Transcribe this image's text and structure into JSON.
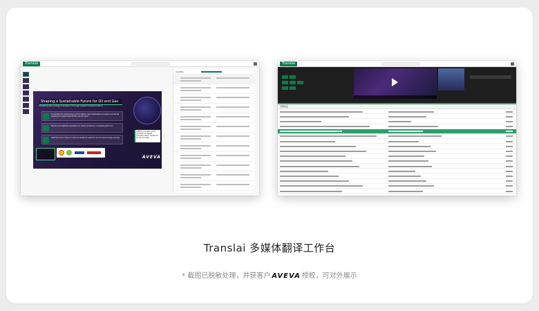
{
  "left_screenshot": {
    "app_logo": "Translai",
    "slide": {
      "title": "Shaping a Sustainable Future for Oil and Gas",
      "subtitle": "Enabling the energy transition through digital transformation",
      "bullets": [
        "Accelerate the engineering cycle to design new sustainable processes and retrofit existing processes towards the net-zero goal",
        "Monitor and optimize operations to reduce emissions, increasing plant and ",
        "Optimize value chains to improve feedstock selection and increase energy savings"
      ],
      "callout_text": "AVEVA provides a full portfolio of digital transformation solutions for Oil and gas",
      "brand": "AVEVA"
    },
    "panel_header": "Subtitle",
    "colors": {
      "accent": "#0e7a4a",
      "slide_bg": "#2d1d4a"
    }
  },
  "right_screenshot": {
    "app_logo": "Translai",
    "table_header": "字幕列表",
    "row_count": 17,
    "colors": {
      "accent": "#0e7a4a",
      "dark_bg": "#1e1e1e",
      "highlight": "#2aa06a"
    }
  },
  "caption": "Translai 多媒体翻译工作台",
  "note": {
    "prefix": "* 截图已脱敏处理，并获客户",
    "brand": "AVEVA",
    "suffix": "授权，可对外展示"
  }
}
